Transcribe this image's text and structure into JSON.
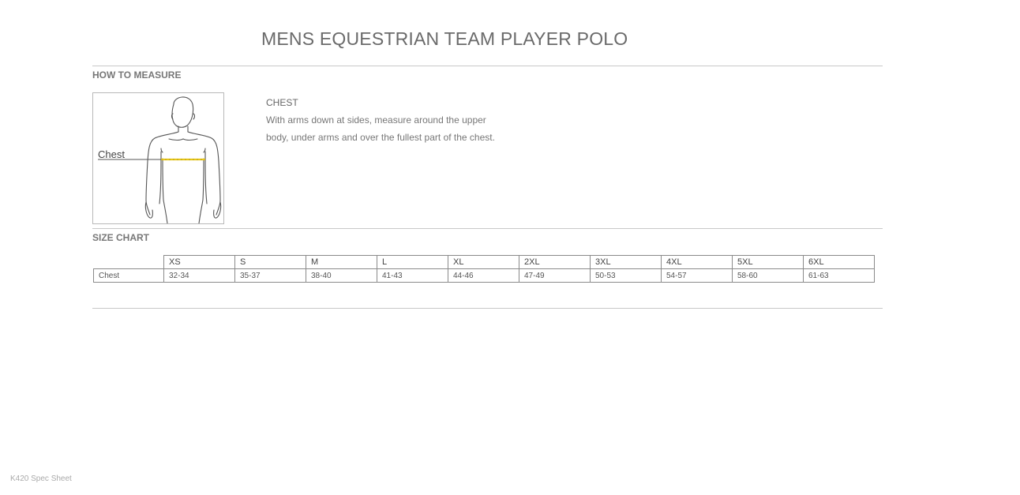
{
  "title": "MENS EQUESTRIAN TEAM PLAYER POLO",
  "how_to_measure": {
    "label": "HOW TO MEASURE",
    "figure_label": "Chest",
    "heading": "CHEST",
    "description": "With arms down at sides, measure around the upper body, under arms and over the fullest part of the chest.",
    "accent_color": "#e8c619"
  },
  "size_chart": {
    "label": "SIZE CHART",
    "columns": [
      "XS",
      "S",
      "M",
      "L",
      "XL",
      "2XL",
      "3XL",
      "4XL",
      "5XL",
      "6XL"
    ],
    "rows": [
      {
        "name": "Chest",
        "values": [
          "32-34",
          "35-37",
          "38-40",
          "41-43",
          "44-46",
          "47-49",
          "50-53",
          "54-57",
          "58-60",
          "61-63"
        ]
      }
    ]
  },
  "footer": "K420 Spec Sheet"
}
